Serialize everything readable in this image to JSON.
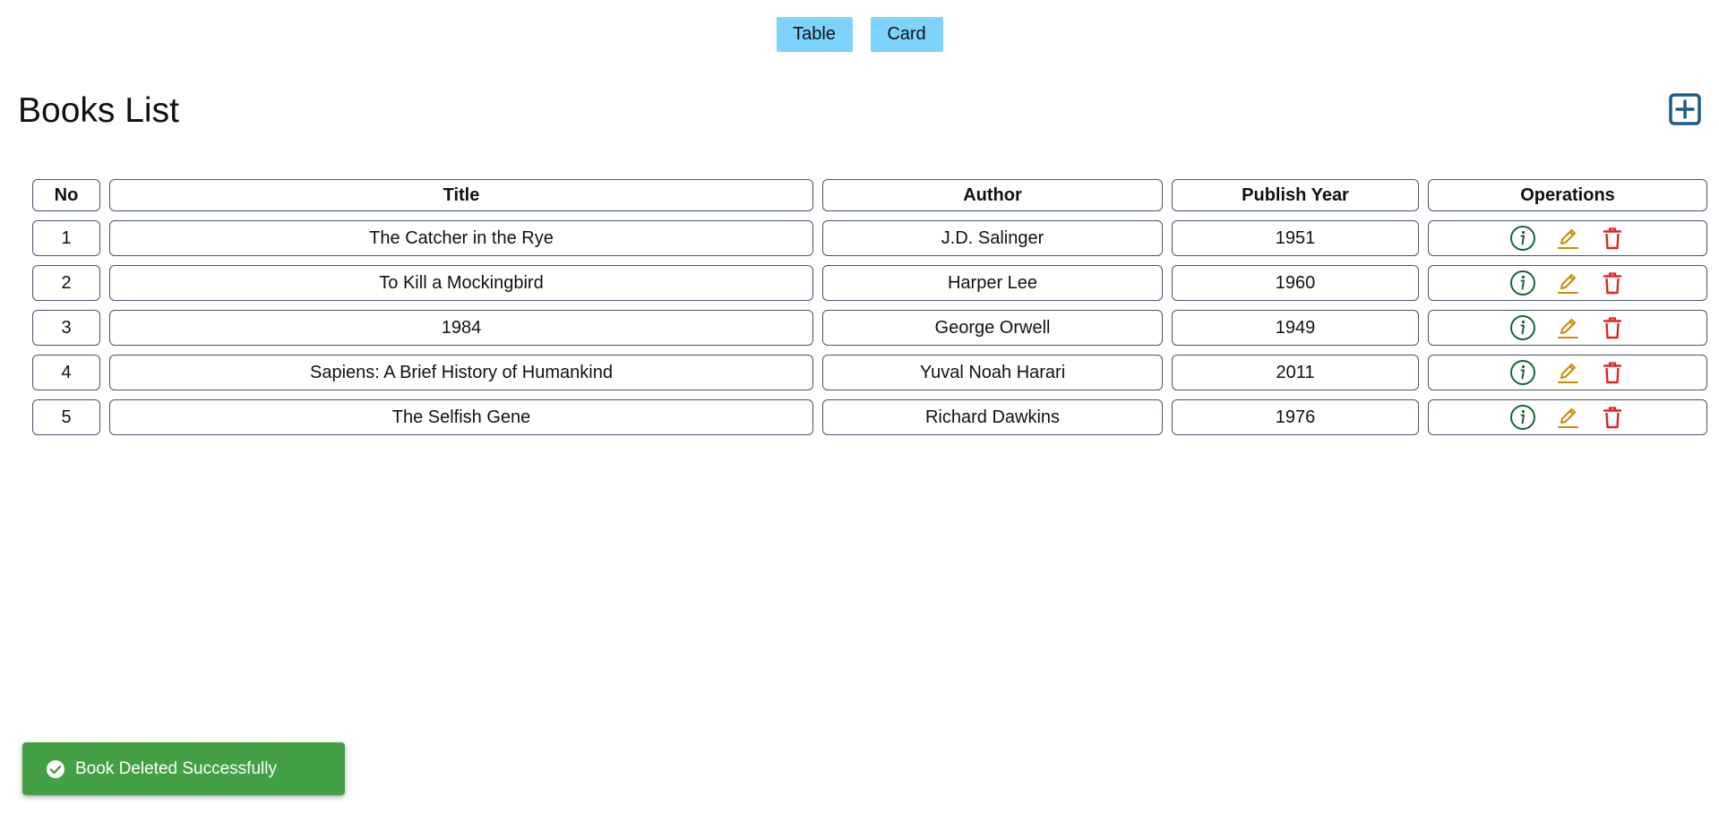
{
  "view_toggle": {
    "table_label": "Table",
    "card_label": "Card"
  },
  "header": {
    "title": "Books List",
    "add_icon": "plus-square-icon"
  },
  "table": {
    "columns": [
      "No",
      "Title",
      "Author",
      "Publish Year",
      "Operations"
    ],
    "rows": [
      {
        "no": "1",
        "title": "The Catcher in the Rye",
        "author": "J.D. Salinger",
        "year": "1951"
      },
      {
        "no": "2",
        "title": "To Kill a Mockingbird",
        "author": "Harper Lee",
        "year": "1960"
      },
      {
        "no": "3",
        "title": "1984",
        "author": "George Orwell",
        "year": "1949"
      },
      {
        "no": "4",
        "title": "Sapiens: A Brief History of Humankind",
        "author": "Yuval Noah Harari",
        "year": "2011"
      },
      {
        "no": "5",
        "title": "The Selfish Gene",
        "author": "Richard Dawkins",
        "year": "1976"
      }
    ],
    "operation_icons": [
      "info-circle-icon",
      "pencil-icon",
      "trash-icon"
    ]
  },
  "toast": {
    "message": "Book Deleted Successfully",
    "icon": "check-circle-icon"
  },
  "colors": {
    "toggle_bg": "#7dd3fc",
    "add_icon": "#1e5b8a",
    "info_icon": "#166534",
    "edit_icon": "#ca8a04",
    "delete_icon": "#dc2626",
    "toast_bg": "#43a047",
    "cell_border": "#475569"
  }
}
